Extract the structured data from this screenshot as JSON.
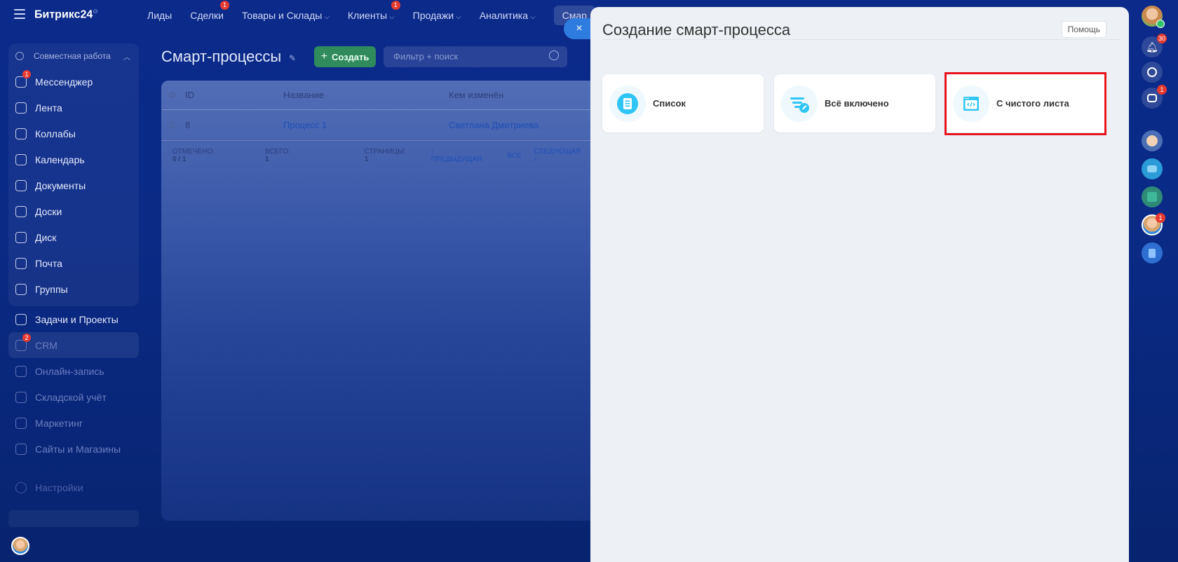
{
  "brand": "Битрикс24",
  "brand_mark": "⊙",
  "topnav": [
    {
      "label": "Лиды",
      "chev": false,
      "badge": ""
    },
    {
      "label": "Сделки",
      "chev": false,
      "badge": "1"
    },
    {
      "label": "Товары и Склады",
      "chev": true,
      "badge": ""
    },
    {
      "label": "Клиенты",
      "chev": true,
      "badge": "1"
    },
    {
      "label": "Продажи",
      "chev": true,
      "badge": ""
    },
    {
      "label": "Аналитика",
      "chev": true,
      "badge": ""
    },
    {
      "label": "Смар",
      "chev": false,
      "badge": ""
    }
  ],
  "sidebar": {
    "group_title": "Совместная работа",
    "group_items": [
      {
        "label": "Мессенджер",
        "badge": "1"
      },
      {
        "label": "Лента",
        "badge": ""
      },
      {
        "label": "Коллабы",
        "badge": ""
      },
      {
        "label": "Календарь",
        "badge": ""
      },
      {
        "label": "Документы",
        "badge": ""
      },
      {
        "label": "Доски",
        "badge": ""
      },
      {
        "label": "Диск",
        "badge": ""
      },
      {
        "label": "Почта",
        "badge": ""
      },
      {
        "label": "Группы",
        "badge": ""
      }
    ],
    "items": [
      {
        "label": "Задачи и Проекты",
        "badge": "",
        "dim": false
      },
      {
        "label": "CRM",
        "badge": "2",
        "dim": true
      },
      {
        "label": "Онлайн-запись",
        "badge": "",
        "dim": true
      },
      {
        "label": "Складской учёт",
        "badge": "",
        "dim": true
      },
      {
        "label": "Маркетинг",
        "badge": "",
        "dim": true
      },
      {
        "label": "Сайты и Магазины",
        "badge": "",
        "dim": true
      }
    ],
    "settings": "Настройки"
  },
  "page": {
    "title": "Смарт-процессы",
    "create_label": "Создать",
    "search_placeholder": "Фильтр + поиск"
  },
  "grid": {
    "headers": {
      "id": "ID",
      "name": "Название",
      "by": "Кем изменён"
    },
    "rows": [
      {
        "id": "8",
        "name": "Процесс 1",
        "by": "Светлана Дмитриева"
      }
    ],
    "footer": {
      "checked_label": "ОТМЕЧЕНО:",
      "checked_value": "0 / 1",
      "total_label": "ВСЕГО:",
      "total_value": "1",
      "pages_label": "СТРАНИЦЫ:",
      "pages_value": "1",
      "prev": "ПРЕДЫДУЩАЯ",
      "all": "ВСЕ",
      "next": "СЛЕДУЮЩАЯ"
    }
  },
  "panel": {
    "close": "×",
    "title": "Создание смарт-процесса",
    "help": "Помощь",
    "cards": [
      {
        "label": "Список",
        "icon": "list-icon"
      },
      {
        "label": "Всё включено",
        "icon": "filter-edit-icon"
      },
      {
        "label": "С чистого листа",
        "icon": "code-window-icon"
      }
    ],
    "accent": "#2fc6f6",
    "highlight_color": "#e8141b"
  },
  "rail": {
    "notifications_count": "30",
    "chat_badge": "1",
    "user_badge": "1"
  }
}
